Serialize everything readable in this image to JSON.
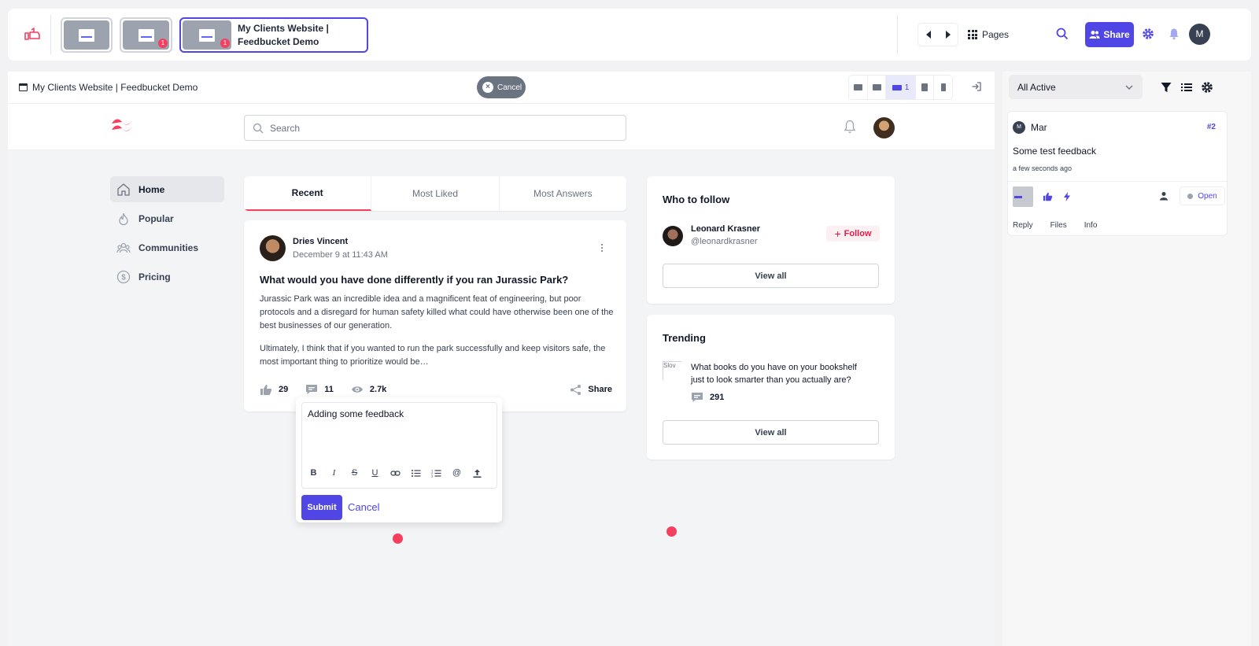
{
  "toolbar": {
    "thumbnails": [
      {
        "badge": ""
      },
      {
        "badge": "1"
      },
      {
        "badge": "1",
        "title": "My Clients Website | Feedbucket Demo"
      }
    ],
    "pages_label": "Pages",
    "share_label": "Share",
    "avatar_initial": "M"
  },
  "preview": {
    "title": "My Clients Website | Feedbucket Demo",
    "cancel_label": "Cancel",
    "active_device_count": "1"
  },
  "site": {
    "search_placeholder": "Search",
    "nav": [
      {
        "label": "Home",
        "icon": "home-icon"
      },
      {
        "label": "Popular",
        "icon": "fire-icon"
      },
      {
        "label": "Communities",
        "icon": "users-icon"
      },
      {
        "label": "Pricing",
        "icon": "dollar-icon"
      }
    ],
    "tabs": [
      "Recent",
      "Most Liked",
      "Most Answers"
    ],
    "post": {
      "author": "Dries Vincent",
      "date": "December 9 at 11:43 AM",
      "title": "What would you have done differently if you ran Jurassic Park?",
      "body_1": "Jurassic Park was an incredible idea and a magnificent feat of engineering, but poor protocols and a disregard for human safety killed what could have otherwise been one of the best businesses of our generation.",
      "body_2": "Ultimately, I think that if you wanted to run the park successfully and keep visitors safe, the most important thing to prioritize would be…",
      "likes": "29",
      "comments": "11",
      "views": "2.7k",
      "share_label": "Share"
    },
    "who_to_follow": {
      "title": "Who to follow",
      "name": "Leonard Krasner",
      "handle": "@leonardkrasner",
      "follow_label": "Follow",
      "view_all": "View all"
    },
    "trending": {
      "title": "Trending",
      "image_alt": "Slov",
      "question": "What books do you have on your bookshelf just to look smarter than you actually are?",
      "count": "291",
      "view_all": "View all"
    }
  },
  "editor": {
    "value": "Adding some feedback",
    "submit_label": "Submit",
    "cancel_label": "Cancel"
  },
  "panel": {
    "filter_value": "All Active",
    "feedback": {
      "avatar_initial": "M",
      "user": "Mar",
      "id": "#2",
      "text": "Some test feedback",
      "time": "a few seconds ago",
      "status": "Open",
      "tabs": [
        "Reply",
        "Files",
        "Info"
      ]
    }
  },
  "colors": {
    "accent": "#4f46e5",
    "brand_red": "#f43f5e"
  }
}
